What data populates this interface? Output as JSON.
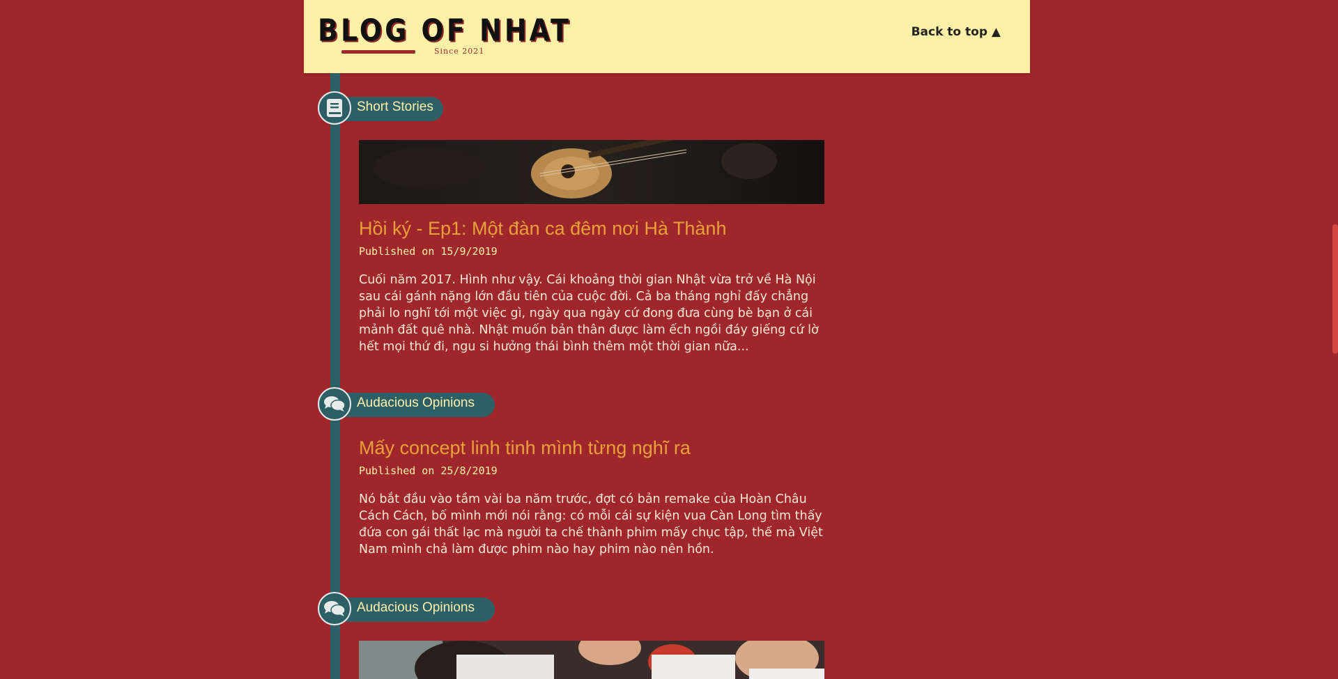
{
  "header": {
    "logo_text": "BLOG OF NHAT",
    "logo_tagline": "Since 2021",
    "back_to_top": "Back to top ▲"
  },
  "colors": {
    "background": "#9f272c",
    "header_bg": "#fdf1a8",
    "timeline": "#2d5f67",
    "title_accent": "#e8a13a",
    "date_color": "#fdf1a8"
  },
  "posts": [
    {
      "category": "Short Stories",
      "category_icon": "book-icon",
      "title": "Hồi ký - Ep1: Một đàn ca đêm nơi Hà Thành",
      "date": "Published on 15/9/2019",
      "excerpt": "Cuối năm 2017. Hình như vậy. Cái khoảng thời gian Nhật vừa trở về Hà Nội sau cái gánh nặng lớn đầu tiên của cuộc đời. Cả ba tháng nghỉ đấy chẳng phải lo nghĩ tới một việc gì, ngày qua ngày cứ đong đưa cùng bè bạn ở cái mảnh đất quê nhà. Nhật muốn bản thân được làm ếch ngồi đáy giếng cứ lờ hết mọi thứ đi, ngu si hưởng thái bình thêm một thời gian nữa..."
    },
    {
      "category": "Audacious Opinions",
      "category_icon": "chat-bubbles-icon",
      "title": "Mấy concept linh tinh mình từng nghĩ ra",
      "date": "Published on 25/8/2019",
      "excerpt": "Nó bắt đầu vào tầm vài ba năm trước, đợt có bản remake của Hoàn Châu Cách Cách, bố mình mới nói rằng: có mỗi cái sự kiện vua Càn Long tìm thấy đứa con gái thất lạc mà người ta chế thành phim mấy chục tập, thế mà Việt Nam mình chả làm được phim nào hay phim nào nên hồn."
    },
    {
      "category": "Audacious Opinions",
      "category_icon": "chat-bubbles-icon"
    }
  ]
}
